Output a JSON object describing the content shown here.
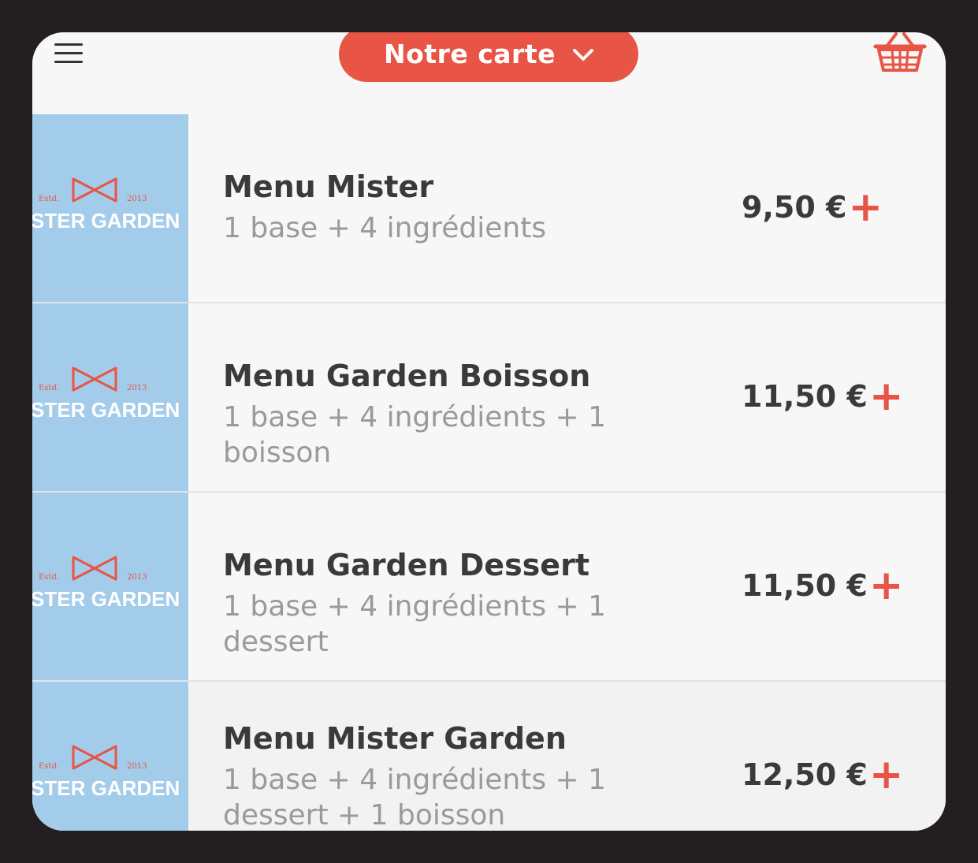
{
  "header": {
    "menu_button_label": "Notre carte"
  },
  "logo": {
    "estd": "Estd.",
    "year": "2013",
    "name": "STER GARDEN"
  },
  "items": [
    {
      "title": "Menu Mister",
      "desc": "1 base + 4 ingrédients",
      "price": "9,50 €"
    },
    {
      "title": "Menu Garden Boisson",
      "desc": "1 base + 4 ingrédients + 1 boisson",
      "price": "11,50 €"
    },
    {
      "title": "Menu Garden Dessert",
      "desc": "1 base + 4 ingrédients + 1 dessert",
      "price": "11,50 €"
    },
    {
      "title": "Menu Mister Garden",
      "desc": "1 base + 4 ingrédients + 1 dessert + 1 boisson",
      "price": "12,50 €"
    }
  ],
  "add_symbol": "+",
  "colors": {
    "accent": "#e85445",
    "thumb_bg": "#a3cceb",
    "text_dark": "#3c3939",
    "text_muted": "#9a9a9a",
    "page_bg": "#f7f7f7"
  },
  "icons": {
    "menu": "hamburger-icon",
    "dropdown": "chevron-down-icon",
    "cart": "basket-icon",
    "add": "plus-icon"
  }
}
